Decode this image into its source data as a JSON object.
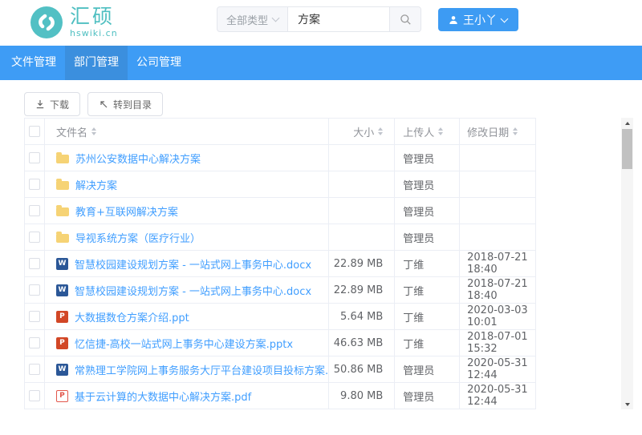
{
  "header": {
    "logo": {
      "name": "汇硕",
      "domain": "hswiki.cn"
    },
    "search": {
      "type_filter": "全部类型",
      "query": "方案"
    },
    "user": {
      "name": "王小丫"
    }
  },
  "nav": {
    "tabs": [
      {
        "label": "文件管理",
        "active": false
      },
      {
        "label": "部门管理",
        "active": true
      },
      {
        "label": "公司管理",
        "active": false
      }
    ]
  },
  "toolbar": {
    "download_label": "下载",
    "goto_directory_label": "转到目录"
  },
  "table": {
    "columns": [
      "文件名",
      "大小",
      "上传人",
      "修改日期"
    ],
    "rows": [
      {
        "type": "folder",
        "name": "苏州公安数据中心解决方案",
        "size": "",
        "uploader": "管理员",
        "date": ""
      },
      {
        "type": "folder",
        "name": "解决方案",
        "size": "",
        "uploader": "管理员",
        "date": ""
      },
      {
        "type": "folder",
        "name": "教育+互联网解决方案",
        "size": "",
        "uploader": "管理员",
        "date": ""
      },
      {
        "type": "folder",
        "name": "导视系统方案（医疗行业）",
        "size": "",
        "uploader": "管理员",
        "date": ""
      },
      {
        "type": "word",
        "name": "智慧校园建设规划方案 - 一站式网上事务中心.docx",
        "size": "22.89 MB",
        "uploader": "丁维",
        "date": "2018-07-21 18:40"
      },
      {
        "type": "word",
        "name": "智慧校园建设规划方案 - 一站式网上事务中心.docx",
        "size": "22.89 MB",
        "uploader": "丁维",
        "date": "2018-07-21 18:40"
      },
      {
        "type": "ppt",
        "name": "大数据数仓方案介绍.ppt",
        "size": "5.64 MB",
        "uploader": "丁维",
        "date": "2020-03-03 10:01"
      },
      {
        "type": "ppt",
        "name": "忆信捷-高校一站式网上事务中心建设方案.pptx",
        "size": "46.63 MB",
        "uploader": "丁维",
        "date": "2018-07-01 15:32"
      },
      {
        "type": "word",
        "name": "常熟理工学院网上事务服务大厅平台建设项目投标方案.doc",
        "size": "50.86 MB",
        "uploader": "管理员",
        "date": "2020-05-31 12:44"
      },
      {
        "type": "pdf",
        "name": "基于云计算的大数据中心解决方案.pdf",
        "size": "9.80 MB",
        "uploader": "管理员",
        "date": "2020-05-31 12:44"
      }
    ]
  },
  "icons": {
    "letters": {
      "word": "W",
      "ppt": "P",
      "pdf": "P",
      "folder": ""
    }
  },
  "colors": {
    "brand_teal": "#4fbfc1",
    "nav_blue": "#3e9cf5",
    "nav_active_blue": "#3b8fde",
    "primary_button_blue": "#3d9bf3",
    "link_blue": "#409eff",
    "folder_yellow": "#f6d375",
    "word_blue": "#2b5797",
    "ppt_orange": "#d24726",
    "pdf_red": "#e2574c",
    "border_gray": "#ebeef5",
    "header_text_gray": "#909399",
    "body_text_gray": "#606266"
  }
}
